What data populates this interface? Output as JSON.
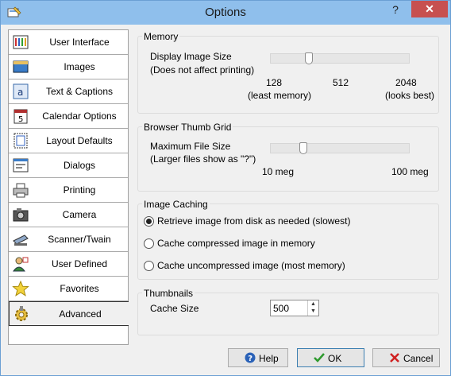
{
  "window": {
    "title": "Options"
  },
  "titlebar": {
    "help_glyph": "?",
    "close_glyph": "✕",
    "app_icon": "options-app-icon"
  },
  "sidebar": {
    "items": [
      {
        "label": "User Interface",
        "icon": "user-interface-icon"
      },
      {
        "label": "Images",
        "icon": "images-icon"
      },
      {
        "label": "Text & Captions",
        "icon": "text-captions-icon"
      },
      {
        "label": "Calendar Options",
        "icon": "calendar-icon"
      },
      {
        "label": "Layout Defaults",
        "icon": "layout-icon"
      },
      {
        "label": "Dialogs",
        "icon": "dialogs-icon"
      },
      {
        "label": "Printing",
        "icon": "printer-icon"
      },
      {
        "label": "Camera",
        "icon": "camera-icon"
      },
      {
        "label": "Scanner/Twain",
        "icon": "scanner-icon"
      },
      {
        "label": "User Defined",
        "icon": "user-defined-icon"
      },
      {
        "label": "Favorites",
        "icon": "star-icon"
      },
      {
        "label": "Advanced",
        "icon": "gear-icon"
      }
    ],
    "selected": "Advanced"
  },
  "memory": {
    "title": "Memory",
    "label1": "Display Image Size",
    "label2": "(Does not affect printing)",
    "tick_min": "128",
    "tick_mid": "512",
    "tick_max": "2048",
    "note_min": "(least memory)",
    "note_max": "(looks best)",
    "slider_fraction": 0.26
  },
  "thumb_grid": {
    "title": "Browser Thumb Grid",
    "label1": "Maximum File Size",
    "label2": "(Larger files show as \"?\")",
    "tick_min": "10 meg",
    "tick_max": "100 meg",
    "slider_fraction": 0.22
  },
  "caching": {
    "title": "Image Caching",
    "options": [
      "Retrieve image from disk as needed (slowest)",
      "Cache compressed image in memory",
      "Cache uncompressed image (most memory)"
    ],
    "selected_index": 0
  },
  "thumbnails": {
    "title": "Thumbnails",
    "cache_label": "Cache Size",
    "cache_value": "500"
  },
  "buttons": {
    "help": "Help",
    "ok": "OK",
    "cancel": "Cancel"
  },
  "colors": {
    "titlebar": "#8fbfec",
    "close": "#c75050",
    "ok_check": "#2e9a2e",
    "cancel_x": "#d02020",
    "help_icon": "#2a62b8"
  }
}
